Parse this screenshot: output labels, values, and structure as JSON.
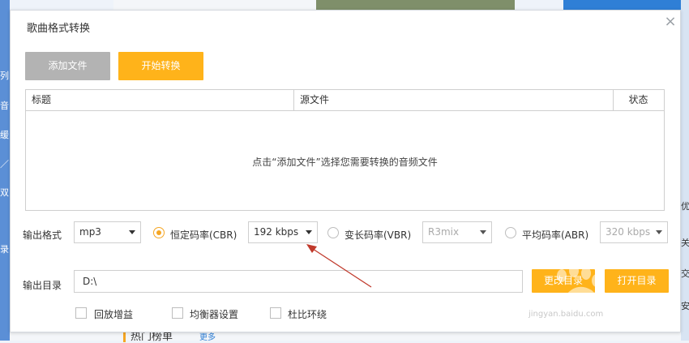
{
  "background": {
    "left_chars": [
      "列",
      "音",
      "缓",
      "／",
      "双",
      "录"
    ],
    "right_chars": [
      "优",
      "关",
      "交",
      "安"
    ],
    "hot_label": "热门榜单",
    "more_label": "更多"
  },
  "dialog": {
    "title": "歌曲格式转换",
    "close_icon": "×"
  },
  "toolbar": {
    "add_file_label": "添加文件",
    "start_convert_label": "开始转换"
  },
  "table": {
    "columns": [
      "标题",
      "源文件",
      "状态"
    ],
    "empty_text": "点击“添加文件”选择您需要转换的音频文件"
  },
  "output_format": {
    "label": "输出格式",
    "format_value": "mp3",
    "cbr": {
      "label": "恒定码率(CBR)",
      "value": "192 kbps",
      "selected": true
    },
    "vbr": {
      "label": "变长码率(VBR)",
      "value": "R3mix",
      "selected": false
    },
    "abr": {
      "label": "平均码率(ABR)",
      "value": "320 kbps",
      "selected": false
    }
  },
  "output_dir": {
    "label": "输出目录",
    "value": "D:\\",
    "change_label": "更改目录",
    "open_label": "打开目录"
  },
  "options": {
    "replay_gain": "回放增益",
    "equalizer": "均衡器设置",
    "dolby": "杜比环绕"
  },
  "watermark": {
    "text": "jingyan.baidu.com"
  },
  "colors": {
    "accent": "#ffb31a",
    "button_disabled": "#b3b3b3",
    "annotation": "#c0392b"
  }
}
